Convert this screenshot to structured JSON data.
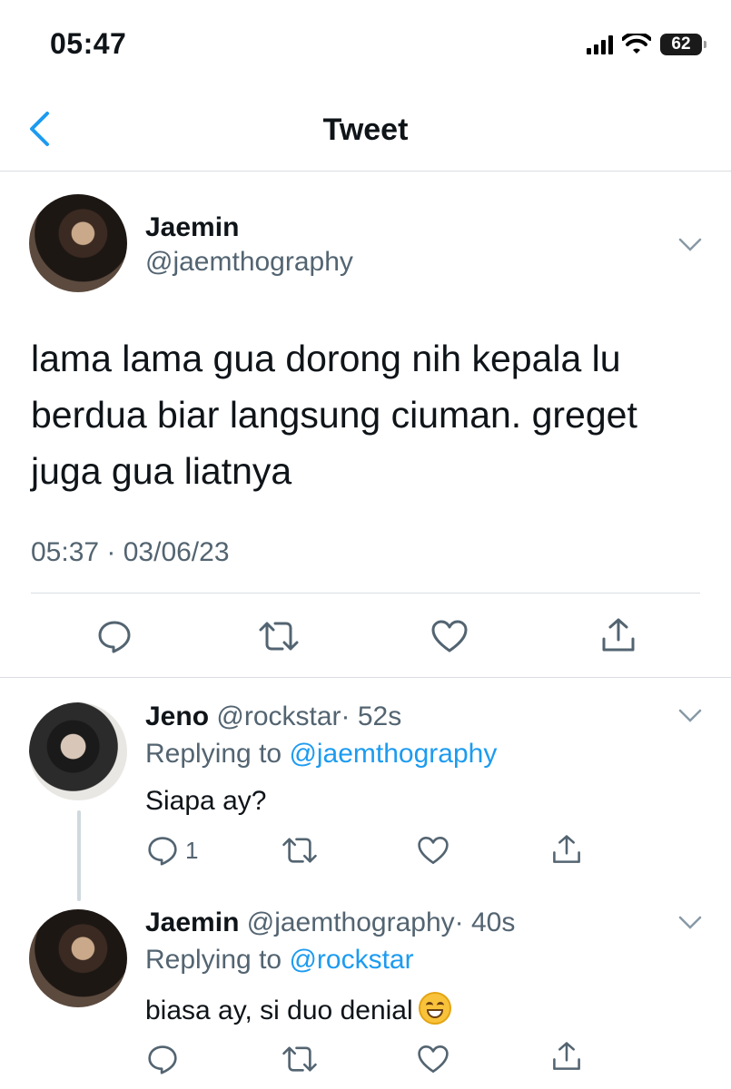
{
  "status_bar": {
    "time": "05:47",
    "battery": "62"
  },
  "header": {
    "title": "Tweet"
  },
  "main_tweet": {
    "name": "Jaemin",
    "handle": "@jaemthography",
    "text": "lama lama gua dorong nih kepala lu berdua biar langsung ciuman. greget juga gua liatnya",
    "timestamp": "05:37 · 03/06/23"
  },
  "replies": [
    {
      "name": "Jeno",
      "handle": "@rockstar",
      "time": "· 52s",
      "replying_label": "Replying to",
      "replying_to": "@jaemthography",
      "text": "Siapa ay?",
      "reply_count": "1"
    },
    {
      "name": "Jaemin",
      "handle": "@jaemthography",
      "time": "· 40s",
      "replying_label": "Replying to",
      "replying_to": "@rockstar",
      "text": "biasa ay, si duo denial",
      "emoji": "grinning-face-with-smiling-eyes"
    }
  ],
  "icons": {
    "back": "chevron-left-icon",
    "reply": "reply-icon",
    "retweet": "retweet-icon",
    "like": "heart-icon",
    "share": "share-icon",
    "more": "chevron-down-icon"
  },
  "colors": {
    "accent": "#1d9bf0",
    "secondary_text": "#536471",
    "divider": "#d9dde1"
  }
}
